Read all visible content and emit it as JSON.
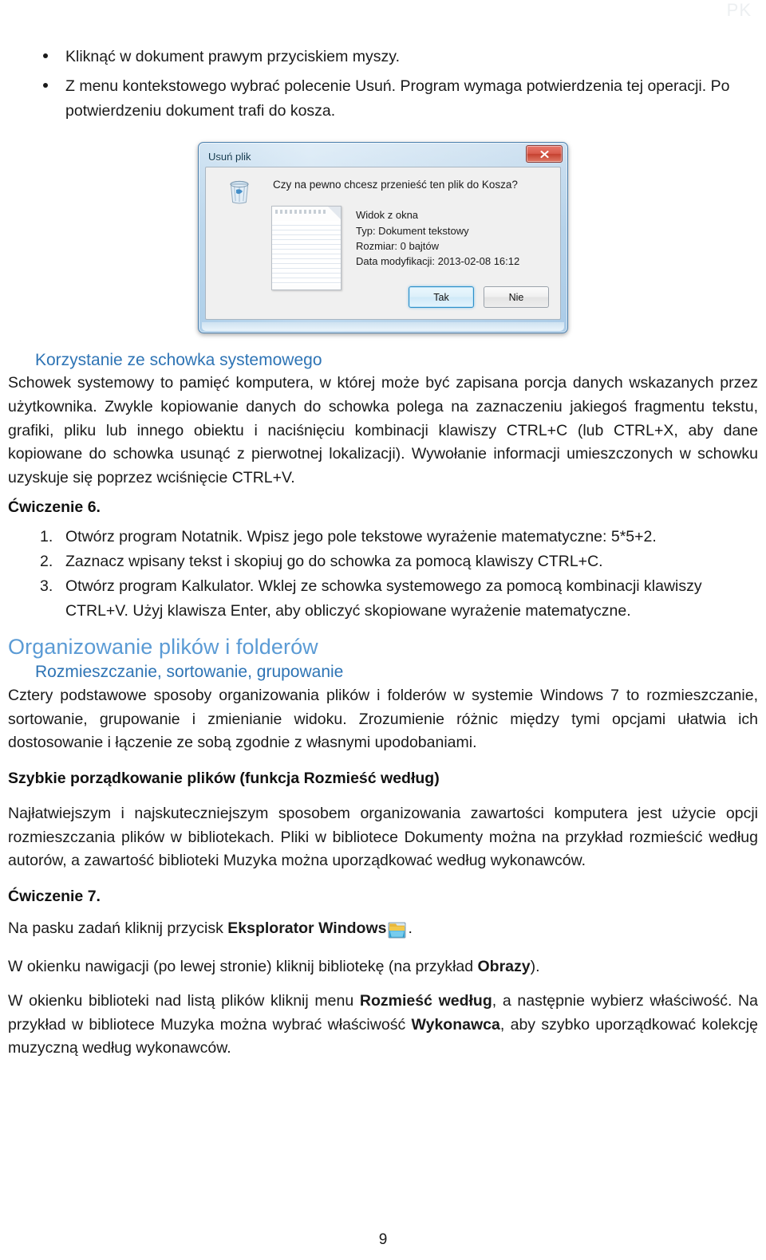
{
  "page": {
    "header_watermark": "PK",
    "page_number": "9"
  },
  "bullets": [
    "Kliknąć w dokument prawym przyciskiem myszy.",
    "Z menu kontekstowego wybrać polecenie Usuń. Program wymaga potwierdzenia tej operacji. Po potwierdzeniu dokument trafi do kosza."
  ],
  "dialog": {
    "title": "Usuń plik",
    "close_label": "x",
    "question": "Czy na pewno chcesz przenieść ten plik do Kosza?",
    "file_name": "Widok z okna",
    "type_line": "Typ: Dokument tekstowy",
    "size_line": "Rozmiar: 0 bajtów",
    "modified_line": "Data modyfikacji: 2013-02-08 16:12",
    "yes_label": "Tak",
    "no_label": "Nie",
    "icon_recycle_bin": "recycle-bin-icon",
    "icon_text_document": "text-document-thumbnail"
  },
  "clipboard_section": {
    "heading": "Korzystanie ze schowka systemowego",
    "paragraph_parts": [
      "Schowek systemowy to pamięć komputera, w której może być zapisana porcja danych wskazanych przez użytkownika. Zwykle kopiowanie danych do schowka polega na zaznaczeniu jakiegoś fragmentu tekstu, grafiki, pliku lub innego obiektu i naciśnięciu kombinacji klawiszy CTRL+C (lub CTRL+X, aby dane kopiowane do schowka usunąć z pierwotnej lokalizacji). Wywołanie informacji umieszczonych w schowku uzyskuje się poprzez wciśnięcie CTRL+V."
    ],
    "exercise_title": "Ćwiczenie 6.",
    "steps": [
      {
        "num": "1.",
        "text": "Otwórz program Notatnik. Wpisz jego pole tekstowe wyrażenie matematyczne: 5*5+2."
      },
      {
        "num": "2.",
        "text": "Zaznacz wpisany tekst i skopiuj go do schowka za pomocą klawiszy CTRL+C."
      },
      {
        "num": "3.",
        "text": "Otwórz program Kalkulator. Wklej ze schowka systemowego za pomocą kombinacji klawiszy CTRL+V. Użyj klawisza Enter, aby obliczyć skopiowane wyrażenie matematyczne."
      }
    ]
  },
  "organizing_section": {
    "heading_1": "Organizowanie plików i folderów",
    "heading_2": "Rozmieszczanie, sortowanie, grupowanie",
    "intro_paragraph": "Cztery podstawowe sposoby organizowania plików i folderów w systemie Windows 7 to rozmieszczanie, sortowanie, grupowanie i zmienianie widoku. Zrozumienie różnic między tymi opcjami ułatwia ich dostosowanie i łączenie ze sobą zgodnie z własnymi upodobaniami.",
    "bold_subheading": "Szybkie porządkowanie plików (funkcja Rozmieść według)",
    "paragraph_2": "Najłatwiejszym i najskuteczniejszym sposobem organizowania zawartości komputera jest użycie opcji rozmieszczania plików w bibliotekach. Pliki w bibliotece Dokumenty można na przykład rozmieścić według autorów, a zawartość biblioteki Muzyka można uporządkować według wykonawców.",
    "exercise_title": "Ćwiczenie 7.",
    "step_1_before": "Na pasku zadań kliknij przycisk ",
    "step_1_bold": "Eksplorator Windows",
    "step_1_after": ".",
    "step_2_before": "W okienku nawigacji (po lewej stronie) kliknij bibliotekę (na przykład ",
    "step_2_bold": "Obrazy",
    "step_2_after": ").",
    "step_3_before": "W okienku biblioteki nad listą plików kliknij menu ",
    "step_3_bold": "Rozmieść według",
    "step_3_mid": ", a następnie wybierz właściwość. Na przykład w bibliotece Muzyka można wybrać właściwość ",
    "step_3_bold2": "Wykonawca",
    "step_3_after": ", aby szybko uporządkować kolekcję muzyczną według wykonawców."
  },
  "colors": {
    "heading_light_blue": "#5B9BD5",
    "heading_blue": "#2E74B5",
    "body_text": "#1A1A1A",
    "watermark": "#ECEFF1",
    "dialog_chrome": "#A9CBE6",
    "close_button_red": "#C5412F"
  }
}
